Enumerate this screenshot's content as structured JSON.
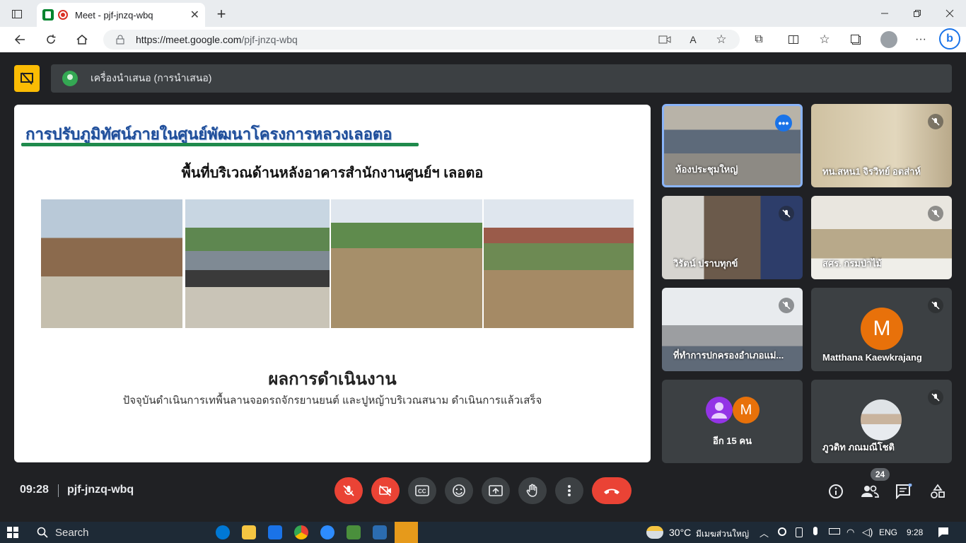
{
  "browser": {
    "tab_title": "Meet - pjf-jnzq-wbq",
    "tab_close": "✕",
    "new_tab": "+",
    "url_host": "https://meet.google.com",
    "url_path": "/pjf-jnzq-wbq"
  },
  "meet": {
    "presenter_label": "เครื่องนำเสนอ (การนำเสนอ)",
    "slide": {
      "title": "การปรับภูมิทัศน์ภายในศูนย์พัฒนาโครงการหลวงเลอตอ",
      "subtitle": "พื้นที่บริเวณด้านหลังอาคารสำนักงานศูนย์ฯ เลอตอ",
      "heading": "ผลการดำเนินงาน",
      "text": "ปัจจุบันดำเนินการเทพื้นลานจอดรถจักรยานยนต์  และปูหญ้าบริเวณสนาม  ดำเนินการแล้วเสร็จ"
    },
    "participants": [
      {
        "name": "ห้องประชุมใหญ่",
        "more": "•••"
      },
      {
        "name": "ทน.สหน1 จิรวิทย์ อตส่าห์"
      },
      {
        "name": "วิรัตน์ ปราบทุกข์"
      },
      {
        "name": "สศร. กรมป่าไม้"
      },
      {
        "name": "ที่ทำการปกครองอำเภอแม่..."
      },
      {
        "name": "Matthana Kaewkrajang",
        "initial": "M"
      },
      {
        "name": "อีก 15 คน",
        "initial": "M"
      },
      {
        "name": "ภูวดิท ภณมณีโชติ"
      }
    ],
    "time": "09:28",
    "meeting_code": "pjf-jnzq-wbq",
    "people_count": "24"
  },
  "taskbar": {
    "search": "Search",
    "weather": "30°C",
    "weather_text": "มีเมฆส่วนใหญ่",
    "lang": "ENG",
    "clock": "9:28"
  },
  "colors": {
    "accent_red": "#ea4335",
    "meet_bg": "#202124",
    "presenter_yellow": "#fbbc04"
  }
}
